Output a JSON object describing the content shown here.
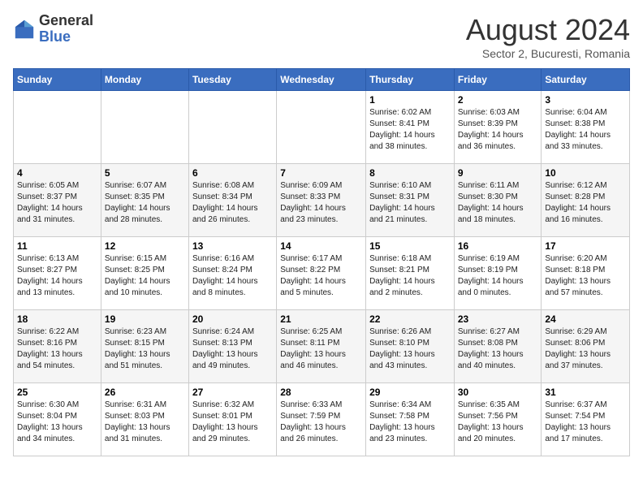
{
  "logo": {
    "general": "General",
    "blue": "Blue"
  },
  "title": {
    "month_year": "August 2024",
    "location": "Sector 2, Bucuresti, Romania"
  },
  "weekdays": [
    "Sunday",
    "Monday",
    "Tuesday",
    "Wednesday",
    "Thursday",
    "Friday",
    "Saturday"
  ],
  "weeks": [
    [
      {
        "day": "",
        "info": ""
      },
      {
        "day": "",
        "info": ""
      },
      {
        "day": "",
        "info": ""
      },
      {
        "day": "",
        "info": ""
      },
      {
        "day": "1",
        "info": "Sunrise: 6:02 AM\nSunset: 8:41 PM\nDaylight: 14 hours\nand 38 minutes."
      },
      {
        "day": "2",
        "info": "Sunrise: 6:03 AM\nSunset: 8:39 PM\nDaylight: 14 hours\nand 36 minutes."
      },
      {
        "day": "3",
        "info": "Sunrise: 6:04 AM\nSunset: 8:38 PM\nDaylight: 14 hours\nand 33 minutes."
      }
    ],
    [
      {
        "day": "4",
        "info": "Sunrise: 6:05 AM\nSunset: 8:37 PM\nDaylight: 14 hours\nand 31 minutes."
      },
      {
        "day": "5",
        "info": "Sunrise: 6:07 AM\nSunset: 8:35 PM\nDaylight: 14 hours\nand 28 minutes."
      },
      {
        "day": "6",
        "info": "Sunrise: 6:08 AM\nSunset: 8:34 PM\nDaylight: 14 hours\nand 26 minutes."
      },
      {
        "day": "7",
        "info": "Sunrise: 6:09 AM\nSunset: 8:33 PM\nDaylight: 14 hours\nand 23 minutes."
      },
      {
        "day": "8",
        "info": "Sunrise: 6:10 AM\nSunset: 8:31 PM\nDaylight: 14 hours\nand 21 minutes."
      },
      {
        "day": "9",
        "info": "Sunrise: 6:11 AM\nSunset: 8:30 PM\nDaylight: 14 hours\nand 18 minutes."
      },
      {
        "day": "10",
        "info": "Sunrise: 6:12 AM\nSunset: 8:28 PM\nDaylight: 14 hours\nand 16 minutes."
      }
    ],
    [
      {
        "day": "11",
        "info": "Sunrise: 6:13 AM\nSunset: 8:27 PM\nDaylight: 14 hours\nand 13 minutes."
      },
      {
        "day": "12",
        "info": "Sunrise: 6:15 AM\nSunset: 8:25 PM\nDaylight: 14 hours\nand 10 minutes."
      },
      {
        "day": "13",
        "info": "Sunrise: 6:16 AM\nSunset: 8:24 PM\nDaylight: 14 hours\nand 8 minutes."
      },
      {
        "day": "14",
        "info": "Sunrise: 6:17 AM\nSunset: 8:22 PM\nDaylight: 14 hours\nand 5 minutes."
      },
      {
        "day": "15",
        "info": "Sunrise: 6:18 AM\nSunset: 8:21 PM\nDaylight: 14 hours\nand 2 minutes."
      },
      {
        "day": "16",
        "info": "Sunrise: 6:19 AM\nSunset: 8:19 PM\nDaylight: 14 hours\nand 0 minutes."
      },
      {
        "day": "17",
        "info": "Sunrise: 6:20 AM\nSunset: 8:18 PM\nDaylight: 13 hours\nand 57 minutes."
      }
    ],
    [
      {
        "day": "18",
        "info": "Sunrise: 6:22 AM\nSunset: 8:16 PM\nDaylight: 13 hours\nand 54 minutes."
      },
      {
        "day": "19",
        "info": "Sunrise: 6:23 AM\nSunset: 8:15 PM\nDaylight: 13 hours\nand 51 minutes."
      },
      {
        "day": "20",
        "info": "Sunrise: 6:24 AM\nSunset: 8:13 PM\nDaylight: 13 hours\nand 49 minutes."
      },
      {
        "day": "21",
        "info": "Sunrise: 6:25 AM\nSunset: 8:11 PM\nDaylight: 13 hours\nand 46 minutes."
      },
      {
        "day": "22",
        "info": "Sunrise: 6:26 AM\nSunset: 8:10 PM\nDaylight: 13 hours\nand 43 minutes."
      },
      {
        "day": "23",
        "info": "Sunrise: 6:27 AM\nSunset: 8:08 PM\nDaylight: 13 hours\nand 40 minutes."
      },
      {
        "day": "24",
        "info": "Sunrise: 6:29 AM\nSunset: 8:06 PM\nDaylight: 13 hours\nand 37 minutes."
      }
    ],
    [
      {
        "day": "25",
        "info": "Sunrise: 6:30 AM\nSunset: 8:04 PM\nDaylight: 13 hours\nand 34 minutes."
      },
      {
        "day": "26",
        "info": "Sunrise: 6:31 AM\nSunset: 8:03 PM\nDaylight: 13 hours\nand 31 minutes."
      },
      {
        "day": "27",
        "info": "Sunrise: 6:32 AM\nSunset: 8:01 PM\nDaylight: 13 hours\nand 29 minutes."
      },
      {
        "day": "28",
        "info": "Sunrise: 6:33 AM\nSunset: 7:59 PM\nDaylight: 13 hours\nand 26 minutes."
      },
      {
        "day": "29",
        "info": "Sunrise: 6:34 AM\nSunset: 7:58 PM\nDaylight: 13 hours\nand 23 minutes."
      },
      {
        "day": "30",
        "info": "Sunrise: 6:35 AM\nSunset: 7:56 PM\nDaylight: 13 hours\nand 20 minutes."
      },
      {
        "day": "31",
        "info": "Sunrise: 6:37 AM\nSunset: 7:54 PM\nDaylight: 13 hours\nand 17 minutes."
      }
    ]
  ]
}
